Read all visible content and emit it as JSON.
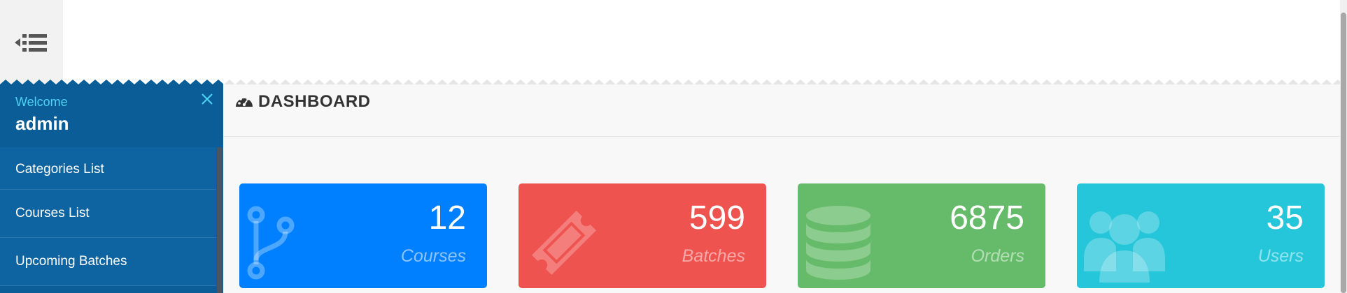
{
  "sidebar": {
    "welcome_label": "Welcome",
    "username": "admin",
    "items": [
      {
        "label": "Categories List"
      },
      {
        "label": "Courses List"
      },
      {
        "label": "Upcoming Batches"
      }
    ]
  },
  "main": {
    "title": "DASHBOARD",
    "cards": [
      {
        "value": "12",
        "label": "Courses",
        "color": "#0080ff",
        "label_color": "#8ec4ff"
      },
      {
        "value": "599",
        "label": "Batches",
        "color": "#ef5350",
        "label_color": "#f8a8a6"
      },
      {
        "value": "6875",
        "label": "Orders",
        "color": "#66bb6a",
        "label_color": "#b3deb5"
      },
      {
        "value": "35",
        "label": "Users",
        "color": "#26c6da",
        "label_color": "#8fe4ee"
      }
    ]
  },
  "colors": {
    "sidebar_bg": "#0a5d97",
    "welcome_accent": "#4fd2f5"
  }
}
